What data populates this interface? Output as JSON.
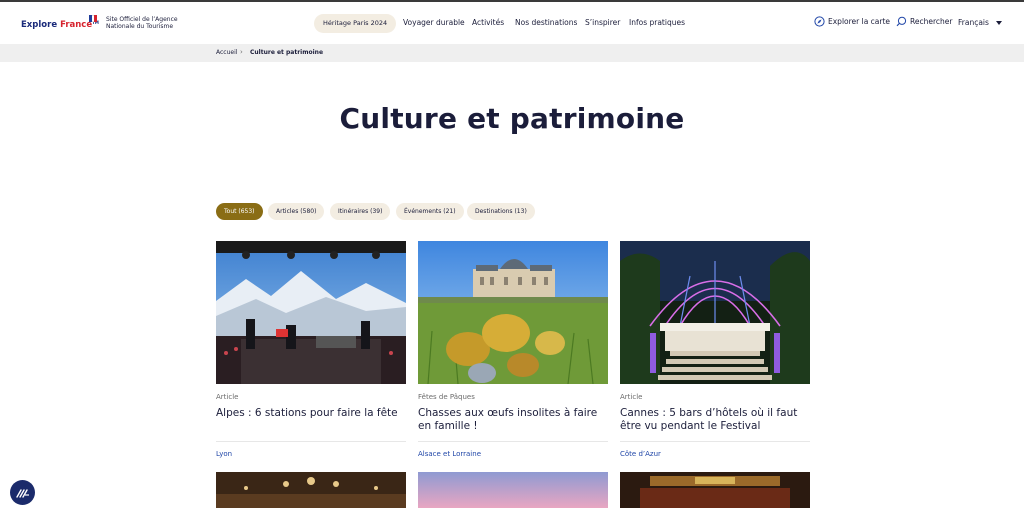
{
  "header": {
    "logo_explore": "Explore",
    "logo_france": "France",
    "logo_tm": "TM",
    "official_line1": "Site Officiel de l’Agence",
    "official_line2": "Nationale du Tourisme",
    "highlight_label": "Héritage Paris 2024",
    "nav": [
      "Voyager durable",
      "Activités",
      "Nos destinations",
      "S’inspirer",
      "Infos pratiques"
    ],
    "map_label": "Explorer la carte",
    "search_label": "Rechercher",
    "language_label": "Français"
  },
  "breadcrumb": [
    "Accueil",
    "Culture et patrimoine"
  ],
  "page_title": "Culture et patrimoine",
  "filters": [
    {
      "label": "Tout (653)",
      "active": true
    },
    {
      "label": "Articles (580)",
      "active": false
    },
    {
      "label": "Itinéraires (39)",
      "active": false
    },
    {
      "label": "Événements (21)",
      "active": false
    },
    {
      "label": "Destinations (13)",
      "active": false
    }
  ],
  "cards": [
    {
      "category": "Article",
      "title": "Alpes : 6 stations pour faire la fête",
      "location": "Lyon",
      "image": "mountain-concert-image"
    },
    {
      "category": "Fêtes de Pâques",
      "title": "Chasses aux œufs insolites à faire en famille !",
      "location": "Alsace et Lorraine",
      "image": "chateau-easter-eggs-image"
    },
    {
      "category": "Article",
      "title": "Cannes : 5 bars d’hôtels où il faut être vu pendant le Festival",
      "location": "Côte d’Azur",
      "image": "hotel-bar-dome-image"
    }
  ],
  "colors": {
    "navy": "#1b1d3a",
    "active_filter": "#8a6d15",
    "pill_bg": "#f3ede2",
    "link_blue": "#2147a8",
    "flag_blue": "#1f3d9a",
    "flag_red": "#d6232e"
  }
}
